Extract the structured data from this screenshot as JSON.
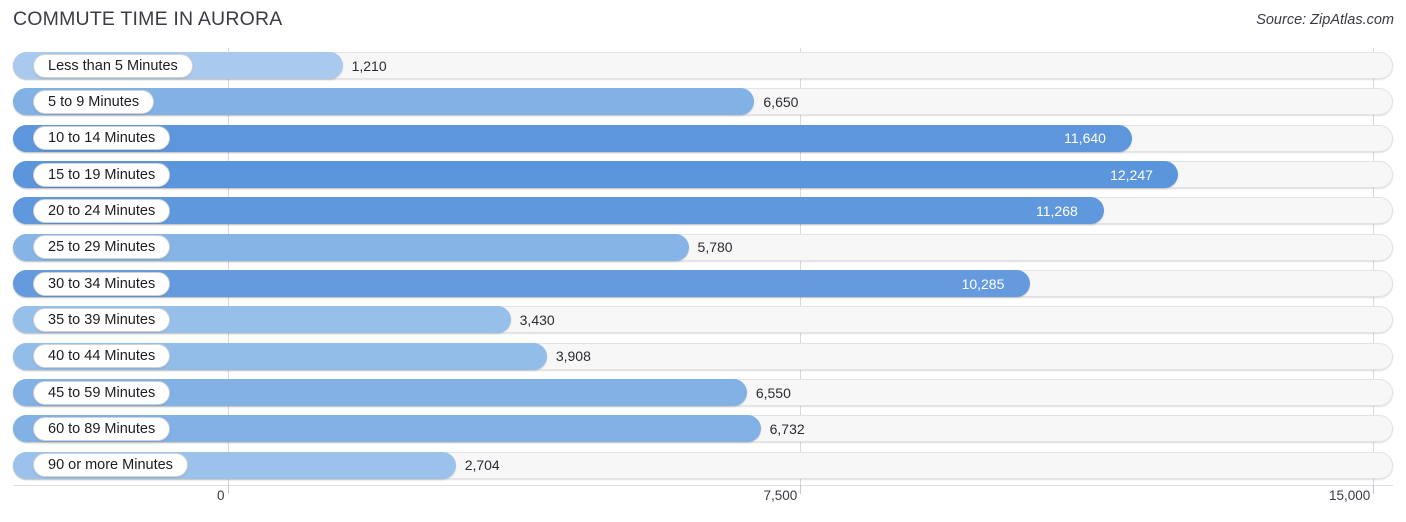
{
  "header": {
    "title": "COMMUTE TIME IN AURORA",
    "source": "Source: ZipAtlas.com"
  },
  "axis": {
    "ticks": [
      "0",
      "7,500",
      "15,000"
    ],
    "tick_values": [
      0,
      7500,
      15000
    ],
    "min": 0,
    "max": 15000
  },
  "rows": [
    {
      "label": "Less than 5 Minutes",
      "value": 1210,
      "value_label": "1,210",
      "color": "#a9c9ee",
      "label_inside": false
    },
    {
      "label": "5 to 9 Minutes",
      "value": 6650,
      "value_label": "6,650",
      "color": "#81b1e5",
      "label_inside": false
    },
    {
      "label": "10 to 14 Minutes",
      "value": 11640,
      "value_label": "11,640",
      "color": "#5d96dc",
      "label_inside": true
    },
    {
      "label": "15 to 19 Minutes",
      "value": 12247,
      "value_label": "12,247",
      "color": "#5b95dc",
      "label_inside": true
    },
    {
      "label": "20 to 24 Minutes",
      "value": 11268,
      "value_label": "11,268",
      "color": "#5f98dd",
      "label_inside": true
    },
    {
      "label": "25 to 29 Minutes",
      "value": 5780,
      "value_label": "5,780",
      "color": "#86b4e6",
      "label_inside": false
    },
    {
      "label": "30 to 34 Minutes",
      "value": 10285,
      "value_label": "10,285",
      "color": "#659bde",
      "label_inside": true
    },
    {
      "label": "35 to 39 Minutes",
      "value": 3430,
      "value_label": "3,430",
      "color": "#96bfea",
      "label_inside": false
    },
    {
      "label": "40 to 44 Minutes",
      "value": 3908,
      "value_label": "3,908",
      "color": "#93bde9",
      "label_inside": false
    },
    {
      "label": "45 to 59 Minutes",
      "value": 6550,
      "value_label": "6,550",
      "color": "#82b2e5",
      "label_inside": false
    },
    {
      "label": "60 to 89 Minutes",
      "value": 6732,
      "value_label": "6,732",
      "color": "#81b1e5",
      "label_inside": false
    },
    {
      "label": "90 or more Minutes",
      "value": 2704,
      "value_label": "2,704",
      "color": "#9ac2eb",
      "label_inside": false
    }
  ],
  "chart_data": {
    "type": "bar",
    "orientation": "horizontal",
    "title": "COMMUTE TIME IN AURORA",
    "subtitle": "",
    "source": "Source: ZipAtlas.com",
    "xlabel": "",
    "ylabel": "",
    "xlim": [
      0,
      15000
    ],
    "xticks": [
      0,
      7500,
      15000
    ],
    "xticklabels": [
      "0",
      "7,500",
      "15,000"
    ],
    "grid": true,
    "legend": "none",
    "categories": [
      "Less than 5 Minutes",
      "5 to 9 Minutes",
      "10 to 14 Minutes",
      "15 to 19 Minutes",
      "20 to 24 Minutes",
      "25 to 29 Minutes",
      "30 to 34 Minutes",
      "35 to 39 Minutes",
      "40 to 44 Minutes",
      "45 to 59 Minutes",
      "60 to 89 Minutes",
      "90 or more Minutes"
    ],
    "values": [
      1210,
      6650,
      11640,
      12247,
      11268,
      5780,
      10285,
      3430,
      3908,
      6550,
      6732,
      2704
    ],
    "value_labels": [
      "1,210",
      "6,650",
      "11,640",
      "12,247",
      "11,268",
      "5,780",
      "10,285",
      "3,430",
      "3,908",
      "6,550",
      "6,732",
      "2,704"
    ]
  }
}
